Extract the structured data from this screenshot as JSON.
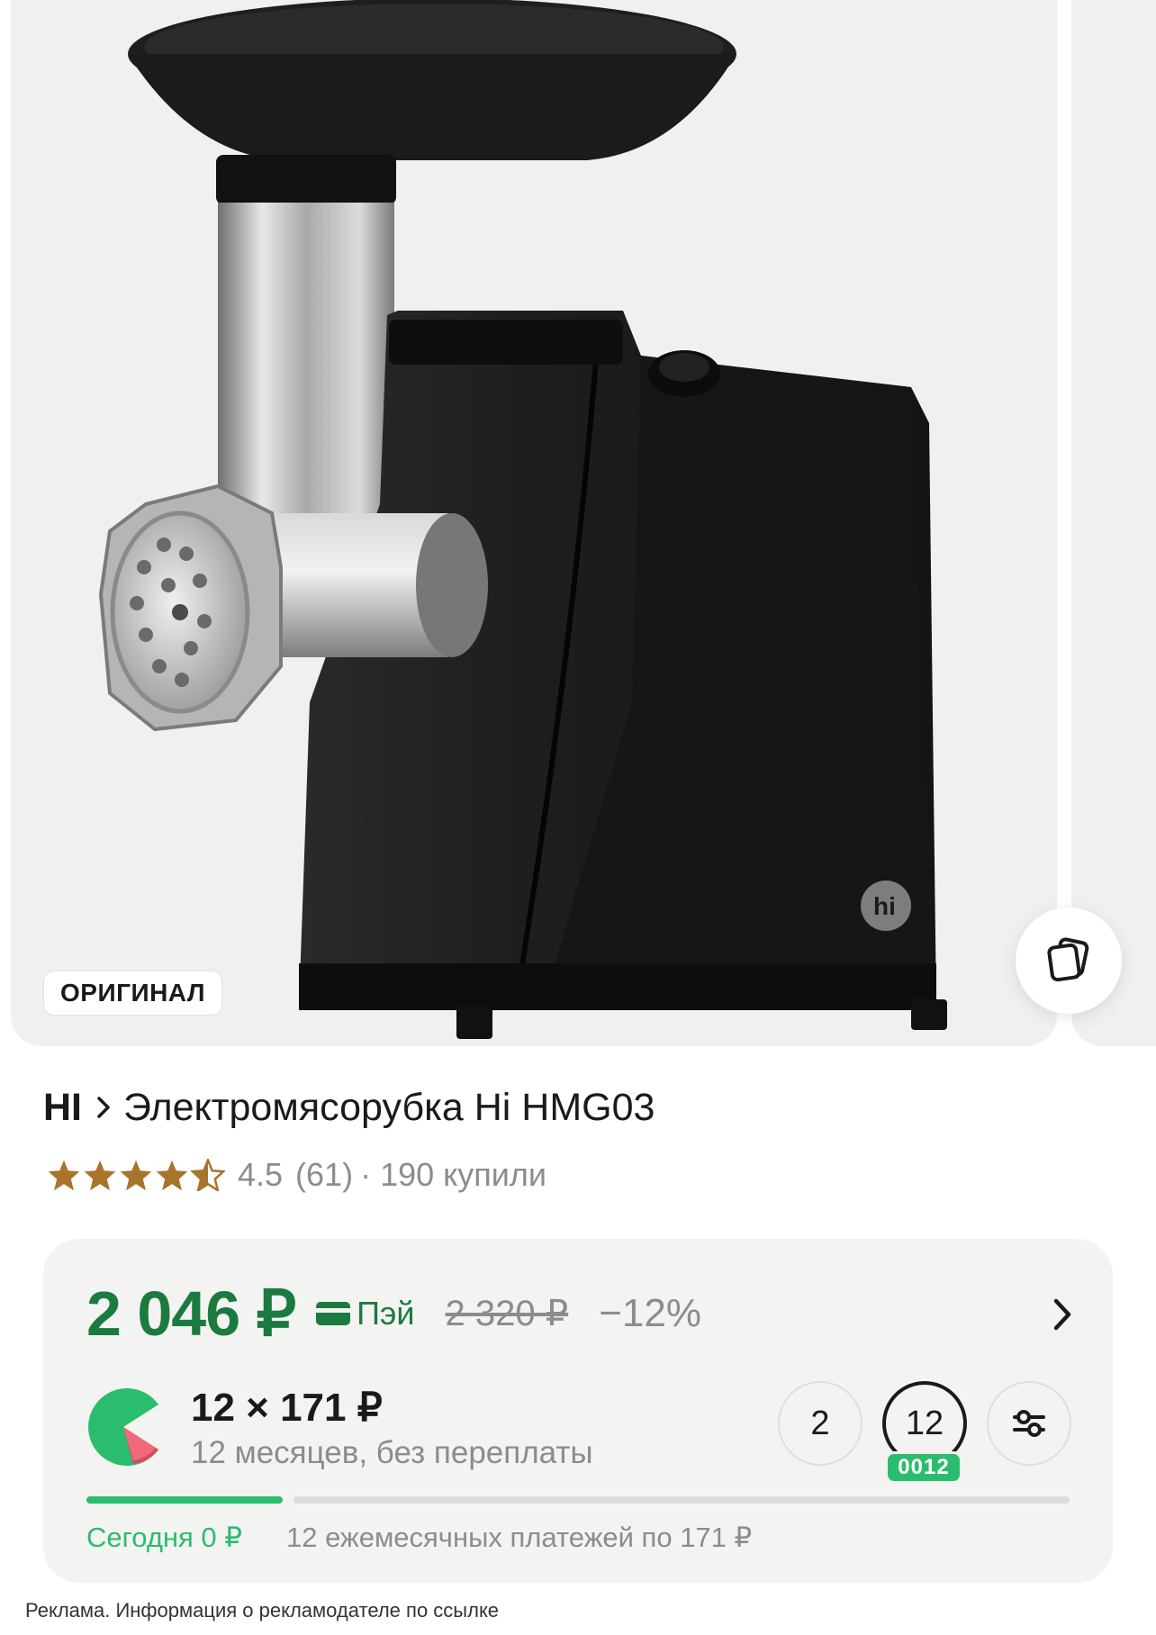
{
  "gallery": {
    "badge_label": "ОРИГИНАЛ",
    "product_logo_text": "hi",
    "icons": {
      "compare": "compare-cards-icon"
    }
  },
  "product": {
    "brand": "HI",
    "title": "Электромясорубка Hi HMG03",
    "rating": "4.5",
    "rating_stars": 4.5,
    "reviews_count": "(61)",
    "bought": "· 190 купили"
  },
  "price": {
    "current": "2 046 ₽",
    "pay_label": "Пэй",
    "old": "2 320 ₽",
    "discount": "−12%",
    "colors": {
      "accent": "#1b7a3f",
      "split_green": "#2bbd6e"
    }
  },
  "split": {
    "amount": "12 × 171 ₽",
    "description": "12 месяцев, без переплаты",
    "terms": [
      "2",
      "12"
    ],
    "selected_term": "12",
    "selected_badge": "0012",
    "progress_paid_fraction": 0.2,
    "today_label": "Сегодня 0 ₽",
    "monthly_label": "12 ежемесячных платежей по 171 ₽"
  },
  "footer": {
    "ad_notice": "Реклама. Информация о рекламодателе по ссылке"
  }
}
